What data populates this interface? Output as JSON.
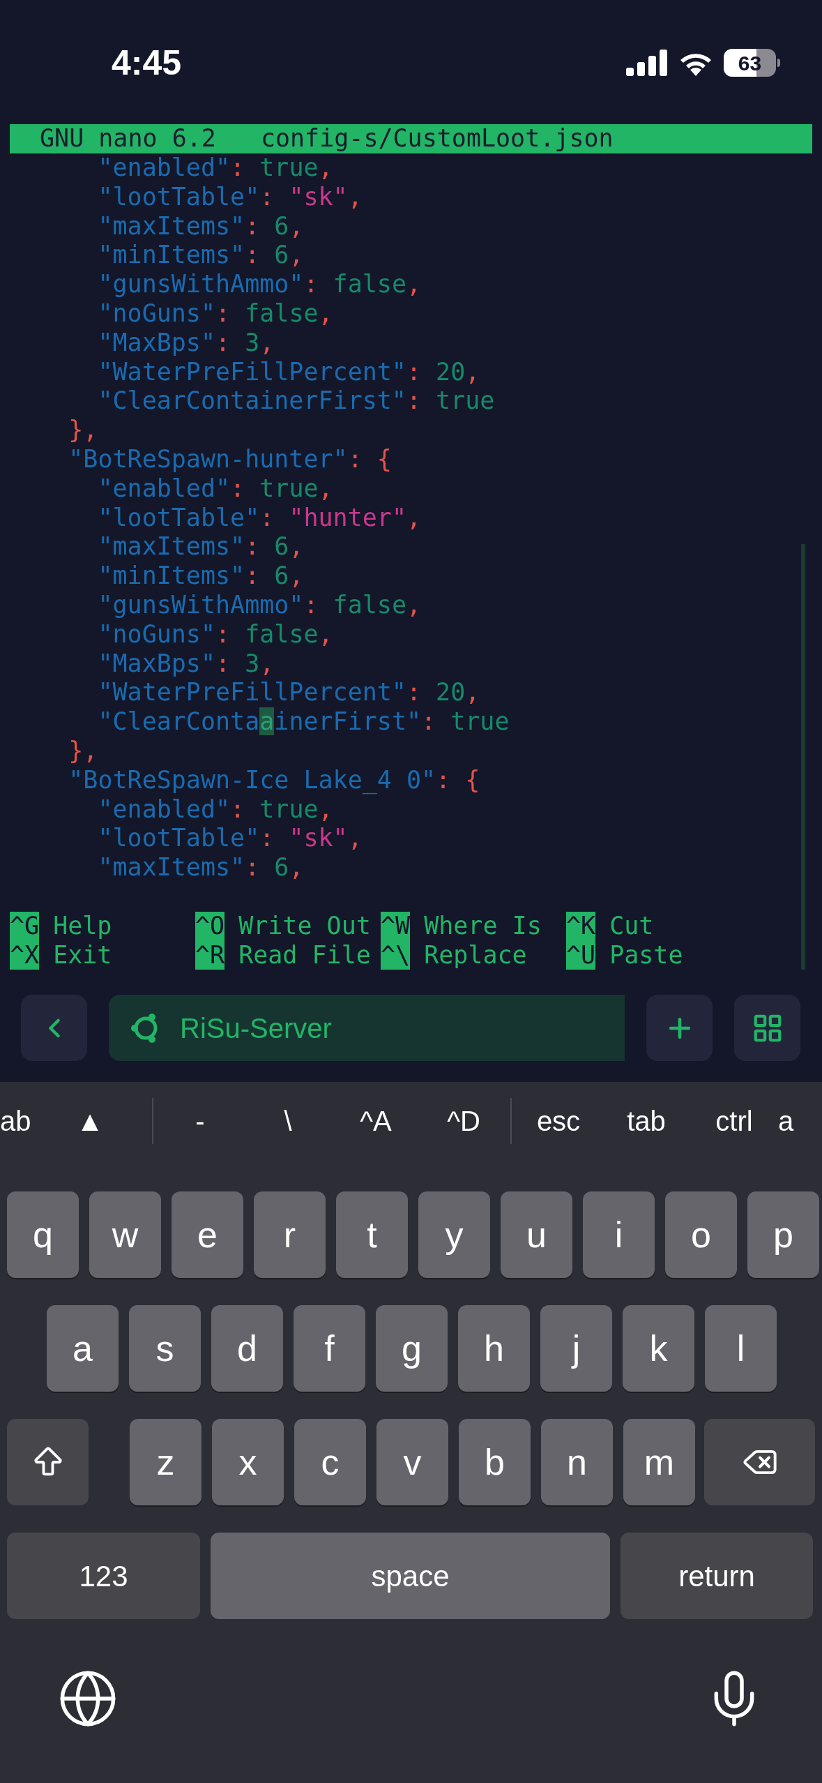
{
  "status_bar": {
    "time": "4:45",
    "battery": "63"
  },
  "editor": {
    "title": "GNU nano 6.2",
    "filename": "config-s/CustomLoot.json",
    "lines": [
      [
        {
          "kind": "key",
          "t": "      \"enabled\""
        },
        {
          "kind": "punct",
          "t": ": "
        },
        {
          "kind": "val",
          "t": "true"
        },
        {
          "kind": "punct",
          "t": ","
        }
      ],
      [
        {
          "kind": "key",
          "t": "      \"lootTable\""
        },
        {
          "kind": "punct",
          "t": ": "
        },
        {
          "kind": "str",
          "t": "\"sk\""
        },
        {
          "kind": "punct",
          "t": ","
        }
      ],
      [
        {
          "kind": "key",
          "t": "      \"maxItems\""
        },
        {
          "kind": "punct",
          "t": ": "
        },
        {
          "kind": "val",
          "t": "6"
        },
        {
          "kind": "punct",
          "t": ","
        }
      ],
      [
        {
          "kind": "key",
          "t": "      \"minItems\""
        },
        {
          "kind": "punct",
          "t": ": "
        },
        {
          "kind": "val",
          "t": "6"
        },
        {
          "kind": "punct",
          "t": ","
        }
      ],
      [
        {
          "kind": "key",
          "t": "      \"gunsWithAmmo\""
        },
        {
          "kind": "punct",
          "t": ": "
        },
        {
          "kind": "val",
          "t": "false"
        },
        {
          "kind": "punct",
          "t": ","
        }
      ],
      [
        {
          "kind": "key",
          "t": "      \"noGuns\""
        },
        {
          "kind": "punct",
          "t": ": "
        },
        {
          "kind": "val",
          "t": "false"
        },
        {
          "kind": "punct",
          "t": ","
        }
      ],
      [
        {
          "kind": "key",
          "t": "      \"MaxBps\""
        },
        {
          "kind": "punct",
          "t": ": "
        },
        {
          "kind": "val",
          "t": "3"
        },
        {
          "kind": "punct",
          "t": ","
        }
      ],
      [
        {
          "kind": "key",
          "t": "      \"WaterPreFillPercent\""
        },
        {
          "kind": "punct",
          "t": ": "
        },
        {
          "kind": "val",
          "t": "20"
        },
        {
          "kind": "punct",
          "t": ","
        }
      ],
      [
        {
          "kind": "key",
          "t": "      \"ClearContainerFirst\""
        },
        {
          "kind": "punct",
          "t": ": "
        },
        {
          "kind": "val",
          "t": "true"
        }
      ],
      [
        {
          "kind": "punct",
          "t": "    },"
        }
      ],
      [
        {
          "kind": "key",
          "t": "    \"BotReSpawn-hunter\""
        },
        {
          "kind": "punct",
          "t": ": {"
        }
      ],
      [
        {
          "kind": "key",
          "t": "      \"enabled\""
        },
        {
          "kind": "punct",
          "t": ": "
        },
        {
          "kind": "val",
          "t": "true"
        },
        {
          "kind": "punct",
          "t": ","
        }
      ],
      [
        {
          "kind": "key",
          "t": "      \"lootTable\""
        },
        {
          "kind": "punct",
          "t": ": "
        },
        {
          "kind": "str",
          "t": "\"hunter\""
        },
        {
          "kind": "punct",
          "t": ","
        }
      ],
      [
        {
          "kind": "key",
          "t": "      \"maxItems\""
        },
        {
          "kind": "punct",
          "t": ": "
        },
        {
          "kind": "val",
          "t": "6"
        },
        {
          "kind": "punct",
          "t": ","
        }
      ],
      [
        {
          "kind": "key",
          "t": "      \"minItems\""
        },
        {
          "kind": "punct",
          "t": ": "
        },
        {
          "kind": "val",
          "t": "6"
        },
        {
          "kind": "punct",
          "t": ","
        }
      ],
      [
        {
          "kind": "key",
          "t": "      \"gunsWithAmmo\""
        },
        {
          "kind": "punct",
          "t": ": "
        },
        {
          "kind": "val",
          "t": "false"
        },
        {
          "kind": "punct",
          "t": ","
        }
      ],
      [
        {
          "kind": "key",
          "t": "      \"noGuns\""
        },
        {
          "kind": "punct",
          "t": ": "
        },
        {
          "kind": "val",
          "t": "false"
        },
        {
          "kind": "punct",
          "t": ","
        }
      ],
      [
        {
          "kind": "key",
          "t": "      \"MaxBps\""
        },
        {
          "kind": "punct",
          "t": ": "
        },
        {
          "kind": "val",
          "t": "3"
        },
        {
          "kind": "punct",
          "t": ","
        }
      ],
      [
        {
          "kind": "key",
          "t": "      \"WaterPreFillPercent\""
        },
        {
          "kind": "punct",
          "t": ": "
        },
        {
          "kind": "val",
          "t": "20"
        },
        {
          "kind": "punct",
          "t": ","
        }
      ],
      [
        {
          "kind": "key",
          "t": "      \"ClearConta"
        },
        {
          "kind": "cursor",
          "t": "a"
        },
        {
          "kind": "key",
          "t": "inerFirst\""
        },
        {
          "kind": "punct",
          "t": ": "
        },
        {
          "kind": "val",
          "t": "true"
        }
      ],
      [
        {
          "kind": "punct",
          "t": "    },"
        }
      ],
      [
        {
          "kind": "key",
          "t": "    \"BotReSpawn-Ice Lake_4 0\""
        },
        {
          "kind": "punct",
          "t": ": {"
        }
      ],
      [
        {
          "kind": "key",
          "t": "      \"enabled\""
        },
        {
          "kind": "punct",
          "t": ": "
        },
        {
          "kind": "val",
          "t": "true"
        },
        {
          "kind": "punct",
          "t": ","
        }
      ],
      [
        {
          "kind": "key",
          "t": "      \"lootTable\""
        },
        {
          "kind": "punct",
          "t": ": "
        },
        {
          "kind": "str",
          "t": "\"sk\""
        },
        {
          "kind": "punct",
          "t": ","
        }
      ],
      [
        {
          "kind": "key",
          "t": "      \"maxItems\""
        },
        {
          "kind": "punct",
          "t": ": "
        },
        {
          "kind": "val",
          "t": "6"
        },
        {
          "kind": "punct",
          "t": ","
        }
      ]
    ],
    "shortcuts": [
      [
        {
          "key": "^G",
          "label": "Help"
        },
        {
          "key": "^O",
          "label": "Write Out"
        },
        {
          "key": "^W",
          "label": "Where Is"
        },
        {
          "key": "^K",
          "label": "Cut"
        }
      ],
      [
        {
          "key": "^X",
          "label": "Exit"
        },
        {
          "key": "^R",
          "label": "Read File"
        },
        {
          "key": "^\\",
          "label": "Replace"
        },
        {
          "key": "^U",
          "label": "Paste"
        }
      ]
    ]
  },
  "toolbar": {
    "session": "RiSu-Server"
  },
  "accessory_keys": [
    {
      "kind": "text",
      "label": "ab"
    },
    {
      "kind": "text",
      "label": "▲"
    },
    {
      "kind": "sep"
    },
    {
      "kind": "text",
      "label": "-"
    },
    {
      "kind": "text",
      "label": "\\"
    },
    {
      "kind": "text",
      "label": "^A"
    },
    {
      "kind": "text",
      "label": "^D"
    },
    {
      "kind": "sep"
    },
    {
      "kind": "text",
      "label": "esc"
    },
    {
      "kind": "text",
      "label": "tab"
    },
    {
      "kind": "text",
      "label": "ctrl"
    },
    {
      "kind": "text",
      "label": "a"
    }
  ],
  "keyboard": {
    "rows": [
      [
        "q",
        "w",
        "e",
        "r",
        "t",
        "y",
        "u",
        "i",
        "o",
        "p"
      ],
      [
        "a",
        "s",
        "d",
        "f",
        "g",
        "h",
        "j",
        "k",
        "l"
      ],
      [
        "z",
        "x",
        "c",
        "v",
        "b",
        "n",
        "m"
      ]
    ],
    "numbers": "123",
    "space": "space",
    "return": "return"
  }
}
